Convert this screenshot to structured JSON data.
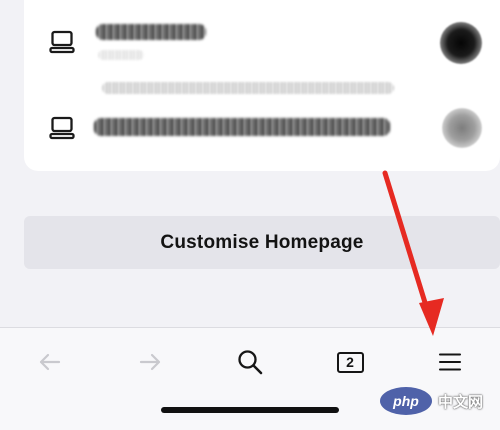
{
  "recent_items": {
    "items": [
      {
        "icon": "laptop-icon"
      },
      {
        "icon": "laptop-icon"
      }
    ]
  },
  "customize_button": {
    "label": "Customise Homepage"
  },
  "toolbar": {
    "back_icon": "back-arrow-icon",
    "forward_icon": "forward-arrow-icon",
    "search_icon": "search-icon",
    "tab_count": "2",
    "menu_icon": "hamburger-menu-icon"
  },
  "annotation": {
    "arrow_color": "#e62a22",
    "target": "menu"
  },
  "watermark": {
    "logo_text": "php",
    "text": "中文网"
  }
}
